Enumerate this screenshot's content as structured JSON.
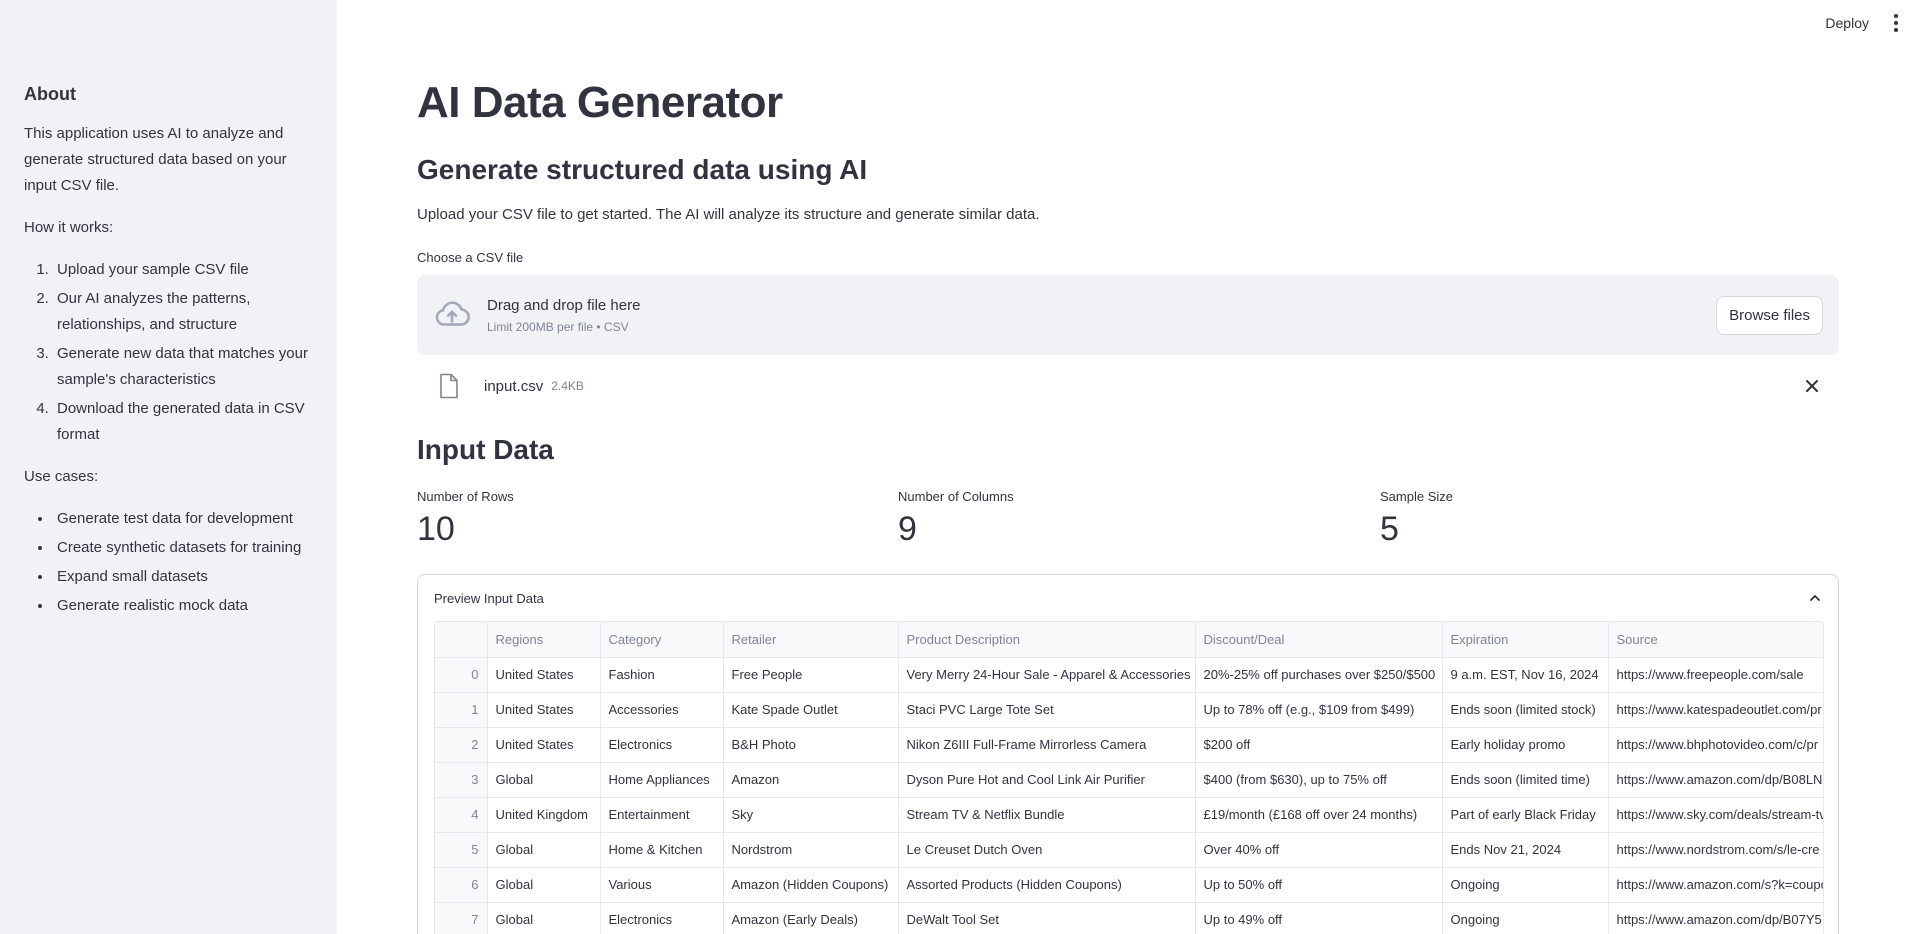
{
  "sidebar": {
    "heading": "About",
    "description": "This application uses AI to analyze and generate structured data based on your input CSV file.",
    "how_label": "How it works:",
    "steps": [
      "Upload your sample CSV file",
      "Our AI analyzes the patterns, relationships, and structure",
      "Generate new data that matches your sample's characteristics",
      "Download the generated data in CSV format"
    ],
    "usecases_label": "Use cases:",
    "usecases": [
      "Generate test data for development",
      "Create synthetic datasets for training",
      "Expand small datasets",
      "Generate realistic mock data"
    ]
  },
  "topbar": {
    "deploy_label": "Deploy",
    "menu_icon": "kebab-menu-icon"
  },
  "main": {
    "title": "AI Data Generator",
    "subtitle": "Generate structured data using AI",
    "intro": "Upload your CSV file to get started. The AI will analyze its structure and generate similar data.",
    "uploader": {
      "label": "Choose a CSV file",
      "drop_text": "Drag and drop file here",
      "limit_text": "Limit 200MB per file • CSV",
      "browse_label": "Browse files",
      "icon": "cloud-upload-icon"
    },
    "file": {
      "name": "input.csv",
      "size": "2.4KB",
      "icon": "file-icon"
    },
    "input_section_title": "Input Data",
    "metrics": [
      {
        "label": "Number of Rows",
        "value": "10"
      },
      {
        "label": "Number of Columns",
        "value": "9"
      },
      {
        "label": "Sample Size",
        "value": "5"
      }
    ],
    "preview": {
      "title": "Preview Input Data",
      "columns": [
        "",
        "Regions",
        "Category",
        "Retailer",
        "Product Description",
        "Discount/Deal",
        "Expiration",
        "Source"
      ],
      "rows": [
        [
          "0",
          "United States",
          "Fashion",
          "Free People",
          "Very Merry 24-Hour Sale - Apparel & Accessories",
          "20%-25% off purchases over $250/$500",
          "9 a.m. EST, Nov 16, 2024",
          "https://www.freepeople.com/sale"
        ],
        [
          "1",
          "United States",
          "Accessories",
          "Kate Spade Outlet",
          "Staci PVC Large Tote Set",
          "Up to 78% off (e.g., $109 from $499)",
          "Ends soon (limited stock)",
          "https://www.katespadeoutlet.com/pr"
        ],
        [
          "2",
          "United States",
          "Electronics",
          "B&H Photo",
          "Nikon Z6III Full-Frame Mirrorless Camera",
          "$200 off",
          "Early holiday promo",
          "https://www.bhphotovideo.com/c/pr"
        ],
        [
          "3",
          "Global",
          "Home Appliances",
          "Amazon",
          "Dyson Pure Hot and Cool Link Air Purifier",
          "$400 (from $630), up to 75% off",
          "Ends soon (limited time)",
          "https://www.amazon.com/dp/B08LN"
        ],
        [
          "4",
          "United Kingdom",
          "Entertainment",
          "Sky",
          "Stream TV & Netflix Bundle",
          "£19/month (£168 off over 24 months)",
          "Part of early Black Friday",
          "https://www.sky.com/deals/stream-tv"
        ],
        [
          "5",
          "Global",
          "Home & Kitchen",
          "Nordstrom",
          "Le Creuset Dutch Oven",
          "Over 40% off",
          "Ends Nov 21, 2024",
          "https://www.nordstrom.com/s/le-cre"
        ],
        [
          "6",
          "Global",
          "Various",
          "Amazon (Hidden Coupons)",
          "Assorted Products (Hidden Coupons)",
          "Up to 50% off",
          "Ongoing",
          "https://www.amazon.com/s?k=coupo"
        ],
        [
          "7",
          "Global",
          "Electronics",
          "Amazon (Early Deals)",
          "DeWalt Tool Set",
          "Up to 49% off",
          "Ongoing",
          "https://www.amazon.com/dp/B07Y5"
        ]
      ]
    }
  }
}
